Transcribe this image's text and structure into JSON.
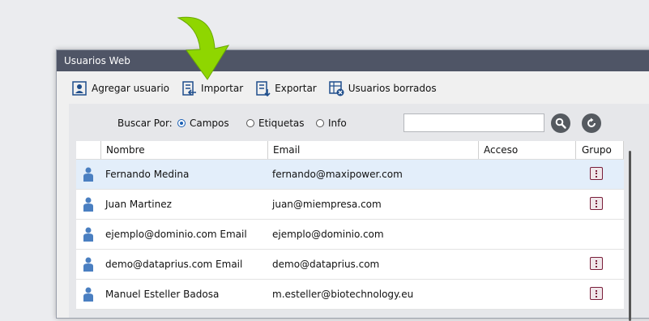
{
  "window": {
    "title": "Usuarios Web"
  },
  "toolbar": [
    {
      "label": "Agregar usuario",
      "icon": "add-user-icon"
    },
    {
      "label": "Importar",
      "icon": "import-icon"
    },
    {
      "label": "Exportar",
      "icon": "export-icon"
    },
    {
      "label": "Usuarios borrados",
      "icon": "deleted-users-icon"
    }
  ],
  "search": {
    "label": "Buscar Por:",
    "options": [
      "Campos",
      "Etiquetas",
      "Info"
    ],
    "selected": "Campos",
    "value": ""
  },
  "table": {
    "columns": [
      "Nombre",
      "Email",
      "Acceso",
      "Grupo"
    ],
    "rows": [
      {
        "name": "Fernando Medina",
        "email": "fernando@maxipower.com",
        "access": "",
        "group": true,
        "selected": true
      },
      {
        "name": "Juan Martinez",
        "email": "juan@miempresa.com",
        "access": "",
        "group": true,
        "selected": false
      },
      {
        "name": "ejemplo@dominio.com Email",
        "email": "ejemplo@dominio.com",
        "access": "",
        "group": false,
        "selected": false
      },
      {
        "name": "demo@dataprius.com Email",
        "email": "demo@dataprius.com",
        "access": "",
        "group": true,
        "selected": false
      },
      {
        "name": "Manuel Esteller Badosa",
        "email": "m.esteller@biotechnology.eu",
        "access": "",
        "group": true,
        "selected": false
      }
    ]
  },
  "colors": {
    "accent": "#1a5fb4",
    "titlebar": "#4f5566",
    "arrow": "#8fd600",
    "group_button": "#7a1e3a"
  }
}
